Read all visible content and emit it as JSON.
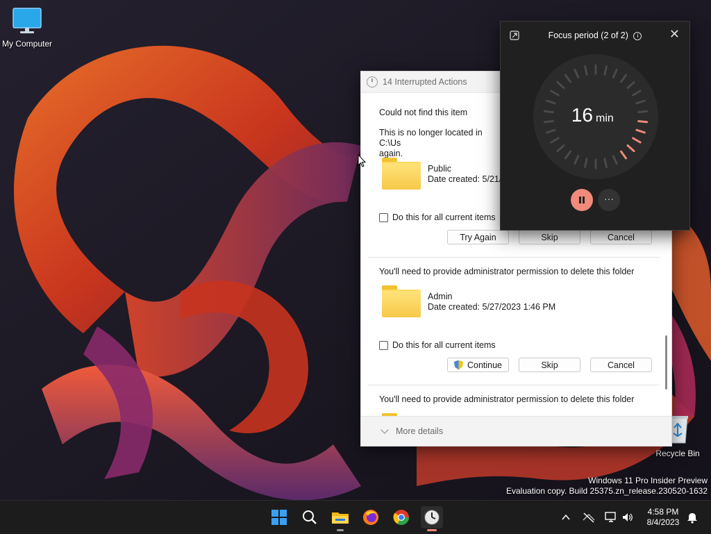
{
  "desktop": {
    "icons": [
      {
        "label": "My Computer",
        "icon": "monitor-icon"
      },
      {
        "label": "Recycle Bin",
        "icon": "recycle-bin-icon"
      }
    ],
    "watermark_line1": "Windows 11 Pro Insider Preview",
    "watermark_line2": "Evaluation copy. Build 25375.zn_release.230520-1632"
  },
  "dialog": {
    "title": "14 Interrupted Actions",
    "items": [
      {
        "heading": "Could not find this item",
        "description": "This is no longer located in C:\\Us",
        "description_line2": "again.",
        "folder_name": "Public",
        "date_created": "Date created: 5/21/2",
        "checkbox_label": "Do this for all current items",
        "buttons": [
          "Try Again",
          "Skip",
          "Cancel"
        ]
      },
      {
        "heading": "You'll need to provide administrator permission to delete this folder",
        "folder_name": "Admin",
        "date_created": "Date created: 5/27/2023 1:46 PM",
        "checkbox_label": "Do this for all current items",
        "buttons": [
          "Continue",
          "Skip",
          "Cancel"
        ]
      },
      {
        "heading": "You'll need to provide administrator permission to delete this folder"
      }
    ],
    "more_details": "More details"
  },
  "focus": {
    "title": "Focus period (2 of 2)",
    "minutes": "16",
    "unit": "min",
    "accent": "#f08a7a",
    "more_label": "···",
    "close_label": "✕"
  },
  "taskbar": {
    "apps": [
      "start-icon",
      "search-icon",
      "file-explorer-icon",
      "firefox-icon",
      "chrome-icon",
      "clock-app-icon"
    ],
    "time": "4:58 PM",
    "date": "8/4/2023"
  }
}
